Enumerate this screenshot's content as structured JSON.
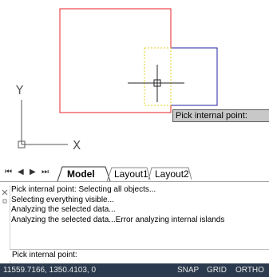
{
  "drawing": {
    "tooltip_text": "Pick internal point:",
    "ucs_y_label": "Y",
    "ucs_x_label": "X",
    "colors": {
      "red_rect": "#e8202a",
      "blue_rect": "#2020a0",
      "dashed_rect": "#e0d020",
      "crosshair": "#222222"
    }
  },
  "tabs": {
    "nav": [
      "⏮",
      "◀",
      "▶",
      "⏭"
    ],
    "items": [
      {
        "label": "Model",
        "active": true
      },
      {
        "label": "Layout1",
        "active": false
      },
      {
        "label": "Layout2",
        "active": false
      }
    ]
  },
  "command": {
    "history": [
      "Pick internal point: Selecting all objects...",
      "Selecting everything visible...",
      "Analyzing the selected data...",
      "Analyzing the selected data...Error analyzing internal islands"
    ],
    "prompt": "Pick internal point:"
  },
  "status": {
    "coords": "11559.7166, 1350.4103, 0",
    "snap": "SNAP",
    "grid": "GRID",
    "ortho": "ORTHO"
  }
}
